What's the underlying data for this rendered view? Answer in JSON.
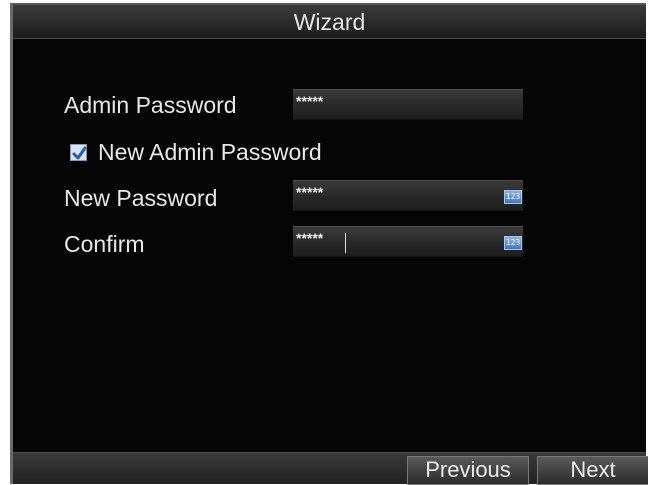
{
  "window": {
    "title": "Wizard"
  },
  "form": {
    "admin_password": {
      "label": "Admin Password",
      "value": "*****"
    },
    "new_admin_password": {
      "label": "New Admin Password",
      "checked": true
    },
    "new_password": {
      "label": "New Password",
      "value": "*****",
      "keyboard_icon": "123"
    },
    "confirm": {
      "label": "Confirm",
      "value": "*****",
      "keyboard_icon": "123"
    }
  },
  "footer": {
    "previous_label": "Previous",
    "next_label": "Next"
  },
  "icons": {
    "checkbox": "checkmark-icon",
    "keyboard": "numeric-keyboard-icon"
  },
  "colors": {
    "background": "#050505",
    "text": "#e8e8e8",
    "accent": "#3f78c4"
  }
}
